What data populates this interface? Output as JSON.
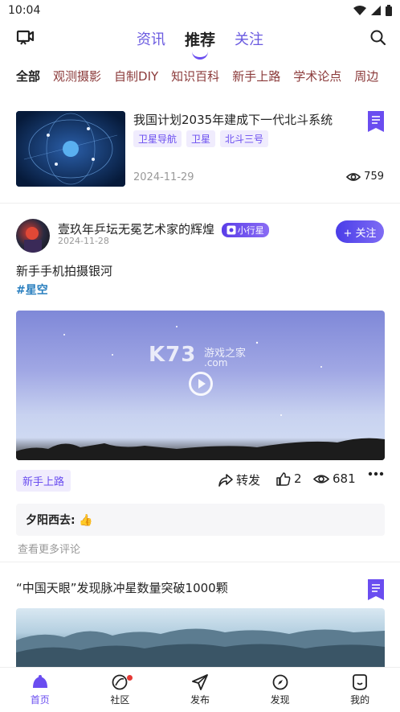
{
  "status": {
    "time": "10:04"
  },
  "top_nav": {
    "tabs": [
      "资讯",
      "推荐",
      "关注"
    ],
    "active_tab": "推荐"
  },
  "categories": [
    "全部",
    "观测摄影",
    "自制DIY",
    "知识百科",
    "新手上路",
    "学术论点",
    "周边"
  ],
  "news1": {
    "title": "我国计划2035年建成下一代北斗系统",
    "tags": [
      "卫星导航",
      "卫星",
      "北斗三号"
    ],
    "date": "2024-11-29",
    "views": "759"
  },
  "post": {
    "author": "壹玖年乒坛无冕艺术家的辉煌",
    "badge": "小行星",
    "date": "2024-11-28",
    "follow_label": "+ 关注",
    "text": "新手手机拍摄银河",
    "hashtag": "#星空",
    "watermark": "K73",
    "watermark_sub": "游戏之家",
    "watermark_url": ".com",
    "tag": "新手上路",
    "share_label": "转发",
    "likes": "2",
    "views": "681",
    "comment_author": "夕阳西去:",
    "comment_text": "👍",
    "more_comments": "查看更多评论"
  },
  "news2": {
    "title": "“中国天眼”发现脉冲星数量突破1000颗"
  },
  "bottom_nav": [
    {
      "label": "首页",
      "active": true
    },
    {
      "label": "社区",
      "active": false
    },
    {
      "label": "发布",
      "active": false
    },
    {
      "label": "发现",
      "active": false
    },
    {
      "label": "我的",
      "active": false
    }
  ],
  "colors": {
    "accent": "#6a4df0",
    "hashtag": "#2a7fbf",
    "category": "#8b3a3a"
  }
}
